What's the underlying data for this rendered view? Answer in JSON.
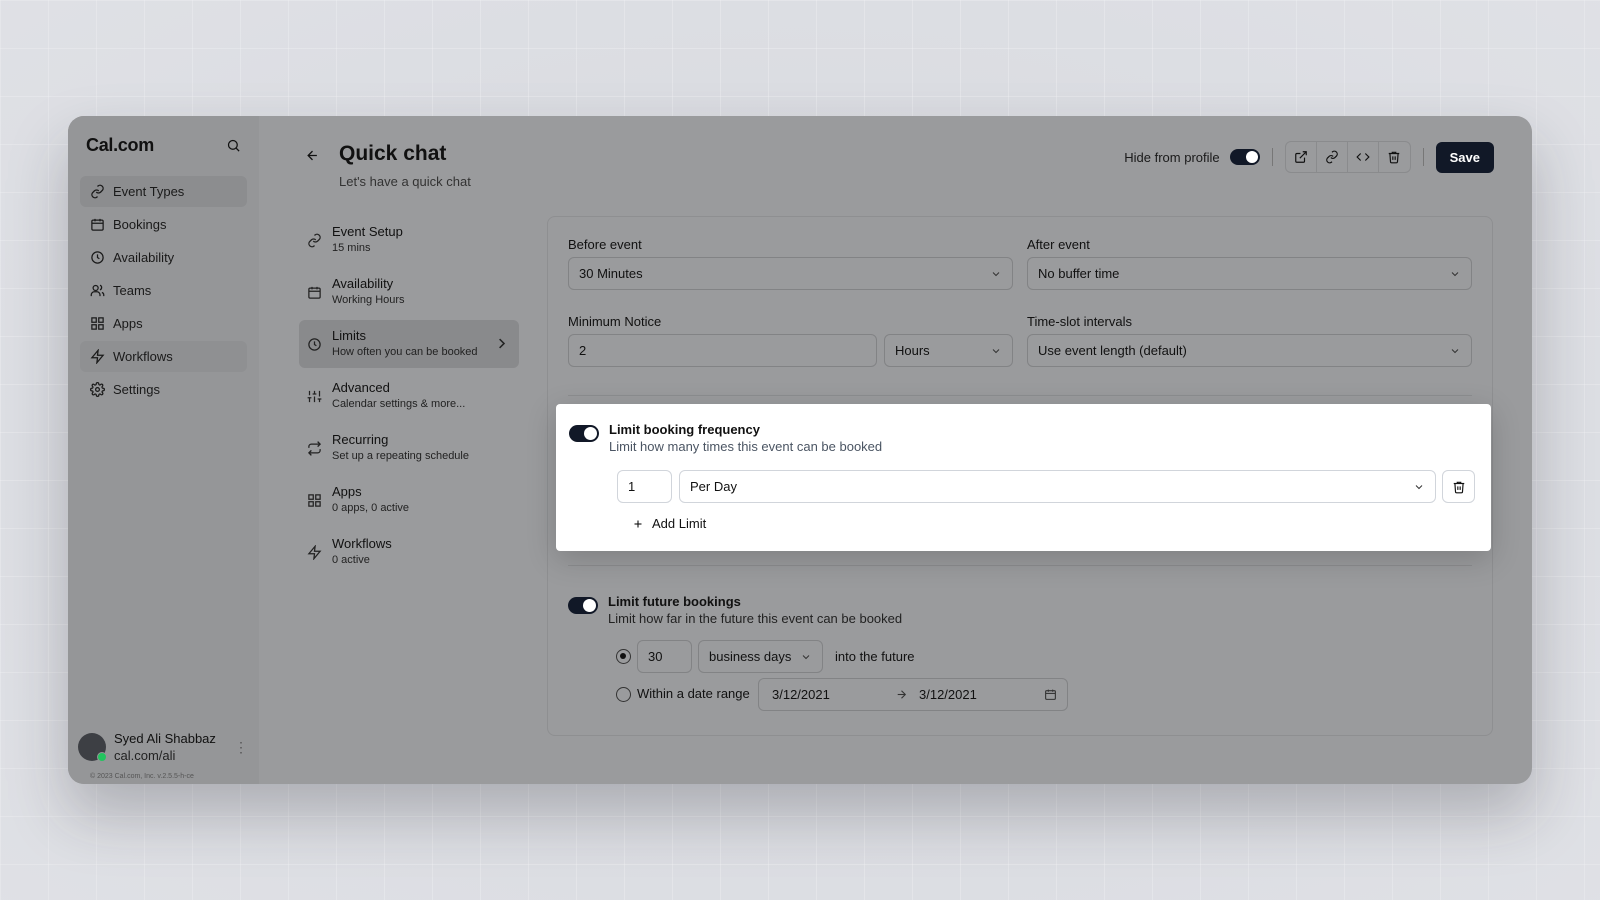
{
  "sidebar": {
    "logo": "Cal.com",
    "items": [
      {
        "label": "Event Types"
      },
      {
        "label": "Bookings"
      },
      {
        "label": "Availability"
      },
      {
        "label": "Teams"
      },
      {
        "label": "Apps"
      },
      {
        "label": "Workflows"
      },
      {
        "label": "Settings"
      }
    ],
    "user": {
      "name": "Syed Ali Shabbaz",
      "handle": "cal.com/ali"
    },
    "copyright": "© 2023 Cal.com, Inc. v.2.5.5-h-ce"
  },
  "header": {
    "title": "Quick chat",
    "subtitle": "Let's have a quick chat",
    "hide_from_profile_label": "Hide from profile",
    "save_label": "Save"
  },
  "subnav": [
    {
      "title": "Event Setup",
      "desc": "15 mins"
    },
    {
      "title": "Availability",
      "desc": "Working Hours"
    },
    {
      "title": "Limits",
      "desc": "How often you can be booked"
    },
    {
      "title": "Advanced",
      "desc": "Calendar settings & more..."
    },
    {
      "title": "Recurring",
      "desc": "Set up a repeating schedule"
    },
    {
      "title": "Apps",
      "desc": "0 apps, 0 active"
    },
    {
      "title": "Workflows",
      "desc": "0 active"
    }
  ],
  "limits": {
    "before_event_label": "Before event",
    "before_event_value": "30 Minutes",
    "after_event_label": "After event",
    "after_event_value": "No buffer time",
    "minimum_notice_label": "Minimum Notice",
    "minimum_notice_value": "2",
    "minimum_notice_unit": "Hours",
    "time_slot_label": "Time-slot intervals",
    "time_slot_value": "Use event length (default)",
    "frequency": {
      "title": "Limit booking frequency",
      "desc": "Limit how many times this event can be booked",
      "count": "1",
      "period": "Per Day",
      "add_label": "Add Limit"
    },
    "future": {
      "title": "Limit future bookings",
      "desc": "Limit how far in the future this event can be booked",
      "days": "30",
      "days_unit": "business days",
      "into_future": "into the future",
      "range_label": "Within a date range",
      "start_date": "3/12/2021",
      "end_date": "3/12/2021"
    }
  }
}
